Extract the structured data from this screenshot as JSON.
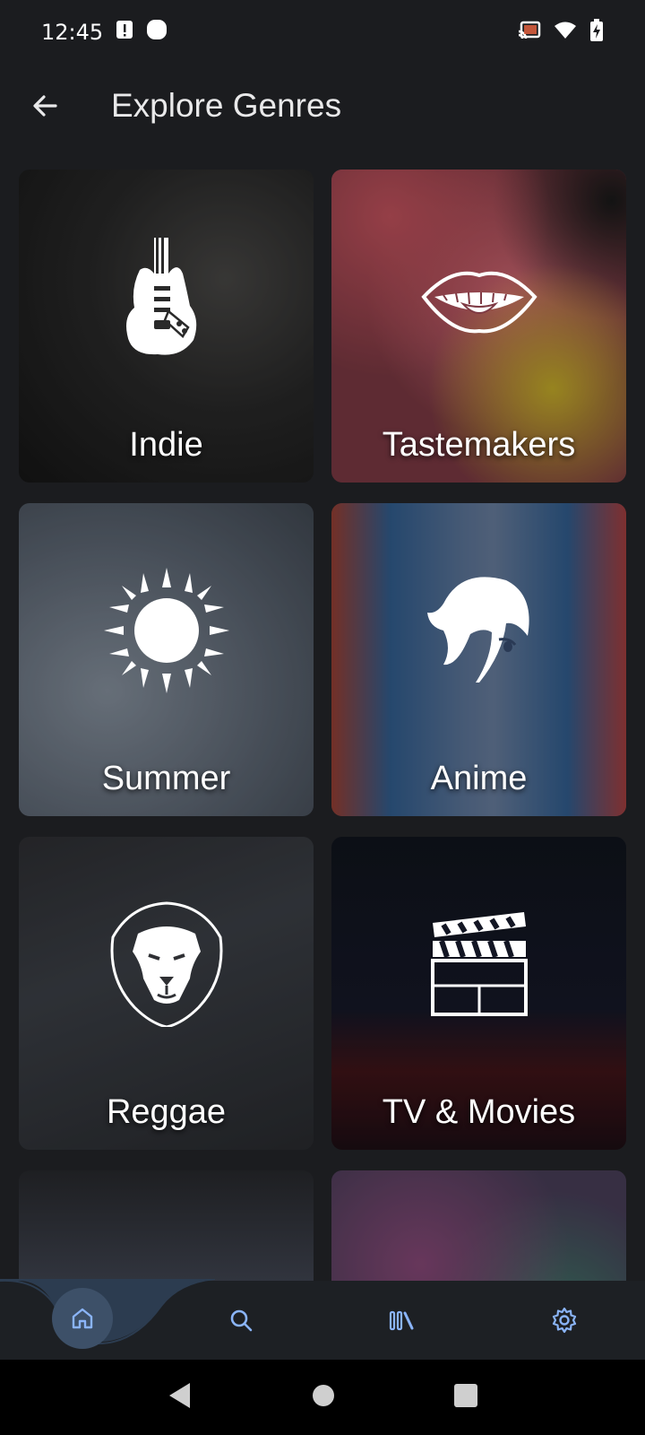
{
  "status": {
    "time": "12:45",
    "icons": [
      "alert-icon",
      "circle-notification-icon",
      "cast-icon",
      "wifi-icon",
      "battery-charging-icon"
    ]
  },
  "header": {
    "title": "Explore Genres",
    "back_icon": "arrow-left-icon"
  },
  "genres": [
    {
      "label": "Indie",
      "icon": "electric-guitar-icon"
    },
    {
      "label": "Tastemakers",
      "icon": "mouth-icon"
    },
    {
      "label": "Summer",
      "icon": "sun-icon"
    },
    {
      "label": "Anime",
      "icon": "anime-girl-icon"
    },
    {
      "label": "Reggae",
      "icon": "lion-icon"
    },
    {
      "label": "TV & Movies",
      "icon": "clapperboard-icon"
    },
    {
      "label": "",
      "icon": "night-sky-icon"
    },
    {
      "label": "",
      "icon": "music-note-icon"
    }
  ],
  "bottom_nav": {
    "items": [
      {
        "icon": "home-icon",
        "active": true
      },
      {
        "icon": "search-icon"
      },
      {
        "icon": "library-icon"
      },
      {
        "icon": "settings-icon"
      }
    ],
    "accent": "#8ab4f8"
  },
  "system_nav": [
    "back-triangle-icon",
    "home-circle-icon",
    "recents-square-icon"
  ]
}
